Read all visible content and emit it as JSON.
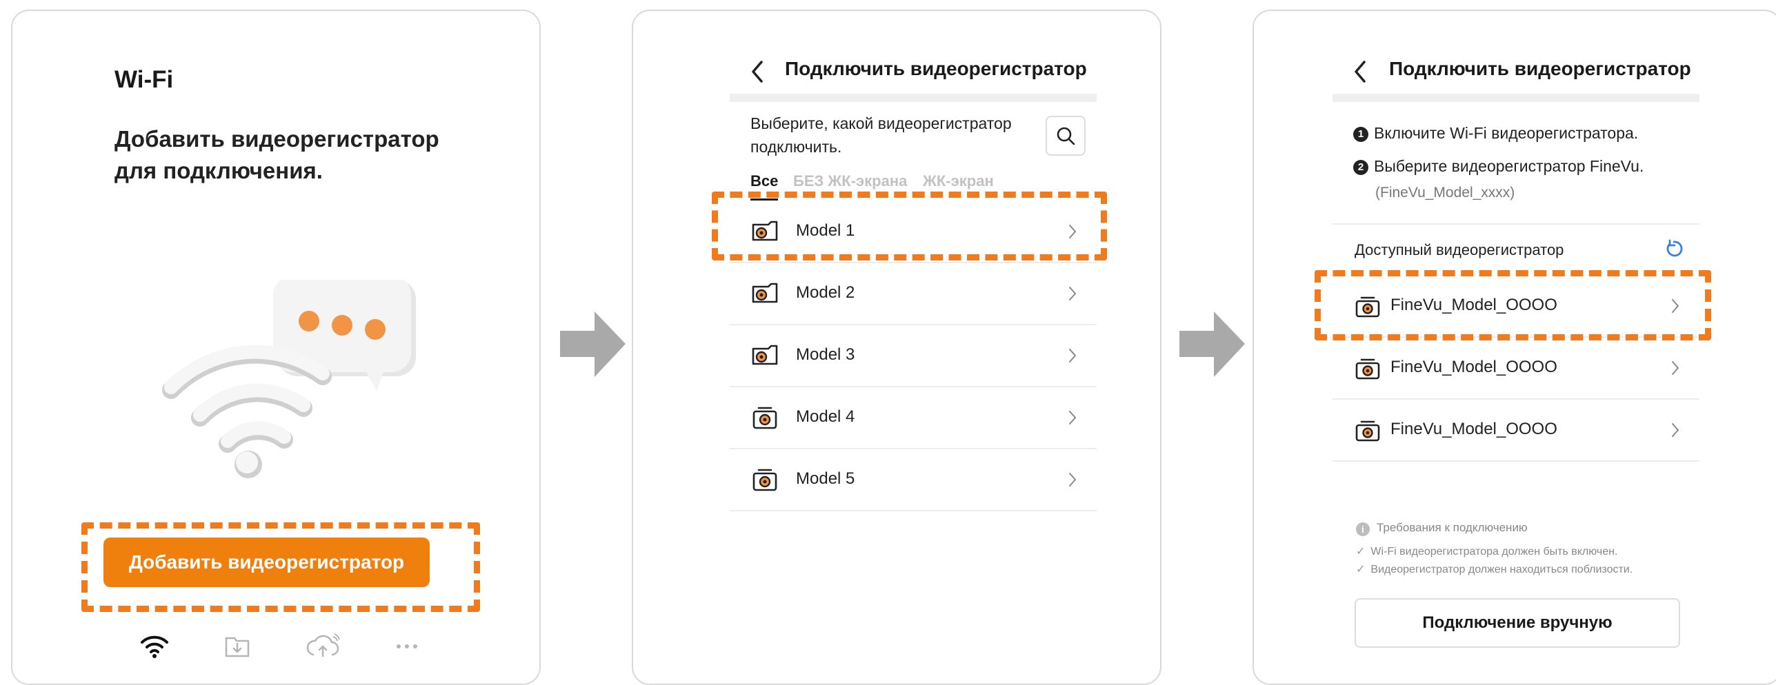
{
  "colors": {
    "accent": "#f0800e",
    "highlight": "#f07a1c",
    "arrow": "#a9a9a9",
    "refresh": "#3d7fe0"
  },
  "panel1": {
    "title": "Wi-Fi",
    "heading_line1": "Добавить видеорегистратор",
    "heading_line2": "для подключения.",
    "add_button": "Добавить видеорегистратор",
    "nav_icons": [
      "wifi-icon",
      "download-folder-icon",
      "cloud-upload-icon",
      "more-icon"
    ]
  },
  "panel2": {
    "title": "Подключить видеорегистратор",
    "instruction": "Выберите, какой видеорегистратор подключить.",
    "tabs": [
      {
        "label": "Все"
      },
      {
        "label": "БЕЗ ЖК-экрана"
      },
      {
        "label": "ЖК-экран"
      }
    ],
    "models": [
      {
        "label": "Model 1",
        "icon": "dashcam-lcd-icon"
      },
      {
        "label": "Model 2",
        "icon": "dashcam-lcd-icon"
      },
      {
        "label": "Model 3",
        "icon": "dashcam-lcd-icon"
      },
      {
        "label": "Model 4",
        "icon": "dashcam-icon"
      },
      {
        "label": "Model 5",
        "icon": "dashcam-icon"
      }
    ]
  },
  "panel3": {
    "title": "Подключить видеорегистратор",
    "step1_num": "1",
    "step1": "Включите Wi-Fi видеорегистратора.",
    "step2_num": "2",
    "step2": "Выберите видеорегистратор FineVu.",
    "step2_sub": "(FineVu_Model_xxxx)",
    "available_label": "Доступный видеорегистратор",
    "devices": [
      {
        "label": "FineVu_Model_OOOO"
      },
      {
        "label": "FineVu_Model_OOOO"
      },
      {
        "label": "FineVu_Model_OOOO"
      }
    ],
    "req_info": "i",
    "requirements_title": "Требования к подключению",
    "requirements": [
      "Wi-Fi видеорегистратора должен быть включен.",
      "Видеорегистратор должен находиться поблизости."
    ],
    "manual_button": "Подключение вручную"
  }
}
